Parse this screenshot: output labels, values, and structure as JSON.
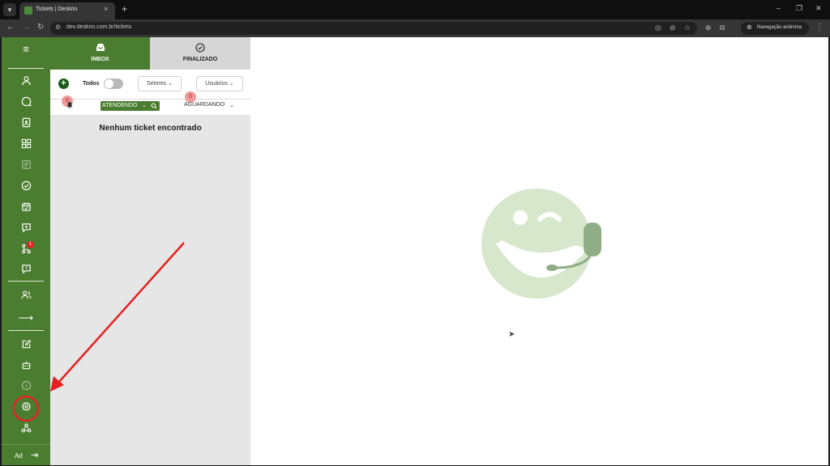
{
  "browser": {
    "tab_title": "Tickets | Deskrio",
    "tab_close": "×",
    "new_tab": "+",
    "url": "dev.deskrio.com.br/tickets",
    "incognito_label": "Navegação anônima",
    "window_controls": [
      "–",
      "❐",
      "✕"
    ]
  },
  "rail": {
    "icons": [
      "user-icon",
      "chat-icon",
      "contacts-icon",
      "apps-icon",
      "kanban-icon",
      "check-circle-icon",
      "calendar-icon",
      "message-plus-icon",
      "flow-icon",
      "feedback-icon",
      "users-icon",
      "arrow-right-icon",
      "edit-icon",
      "bot-icon",
      "info-icon",
      "settings-icon",
      "integrations-icon"
    ],
    "flow_badge": "1",
    "user_initials": "Ad"
  },
  "panel": {
    "tab_inbox": "INBOX",
    "tab_finalizado": "FINALIZADO",
    "todos_label": "Todos",
    "todos_enabled": false,
    "setores_label": "Setores",
    "usuarios_label": "Usuários",
    "atendendo_label": "ATENDENDO",
    "atendendo_count": "0",
    "aguardando_label": "AGUARDANDO",
    "aguardando_count": "0",
    "empty_message": "Nenhum ticket encontrado"
  },
  "colors": {
    "brand_green": "#4b7d30",
    "mascot_green": "#d6e7cb",
    "badge_red": "#e02424",
    "annotation_red": "#e52222"
  }
}
